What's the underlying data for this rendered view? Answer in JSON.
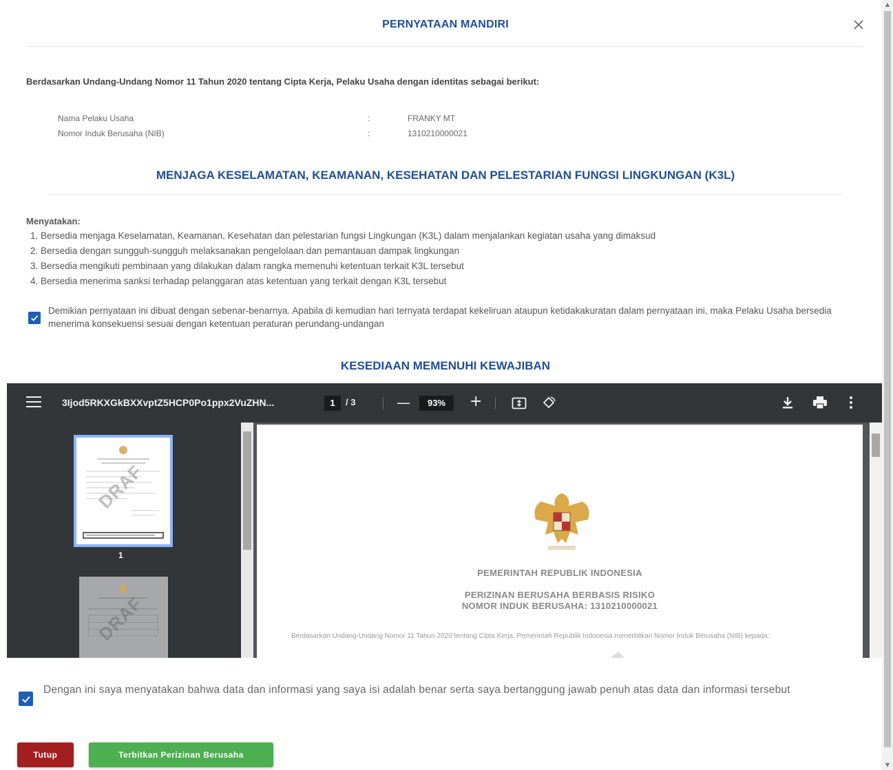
{
  "modal": {
    "title": "PERNYATAAN MANDIRI",
    "intro": "Berdasarkan Undang-Undang Nomor 11 Tahun 2020 tentang Cipta Kerja, Pelaku Usaha dengan identitas sebagai berikut:"
  },
  "identity": [
    {
      "label": "Nama Pelaku Usaha",
      "sep": ":",
      "value": "FRANKY MT"
    },
    {
      "label": "Nomor Induk Berusaha (NIB)",
      "sep": ":",
      "value": "1310210000021"
    }
  ],
  "k3l": {
    "title": "MENJAGA KESELAMATAN, KEAMANAN, KESEHATAN DAN PELESTARIAN FUNGSI LINGKUNGAN (K3L)",
    "statement_label": "Menyatakan:",
    "items": [
      "1. Bersedia menjaga Keselamatan, Keamanan, Kesehatan dan pelestarian fungsi Lingkungan (K3L) dalam menjalankan kegiatan usaha yang dimaksud",
      "2. Bersedia dengan sungguh-sungguh melaksanakan pengelolaan dan pemantauan dampak lingkungan",
      "3. Bersedia mengikuti pembinaan yang dilakukan dalam rangka memenuhi ketentuan terkait K3L tersebut",
      "4. Bersedia menerima sanksi terhadap pelanggaran atas ketentuan yang terkait dengan K3L tersebut"
    ],
    "declaration": "Demikian pernyataan ini dibuat dengan sebenar-benarnya. Apabila di kemudian hari ternyata terdapat kekeliruan ataupun ketidakakuratan dalam pernyataan ini, maka Pelaku Usaha bersedia menerima konsekuensi sesuai dengan ketentuan peraturan perundang-undangan"
  },
  "kewajiban": {
    "title": "KESEDIAAN MEMENUHI KEWAJIBAN"
  },
  "pdf": {
    "filename": "3Ijod5RKXGkBXXvptZ5HCP0Po1ppx2VuZHN...",
    "current_page": "1",
    "total_pages": "/ 3",
    "zoom": "93%",
    "thumb_number": "1",
    "watermark": "DRAF",
    "doc_heading": "PEMERINTAH REPUBLIK INDONESIA",
    "doc_subheading_1": "PERIZINAN BERUSAHA BERBASIS RISIKO",
    "doc_subheading_2": "NOMOR INDUK BERUSAHA: 1310210000021",
    "doc_paragraph": "Berdasarkan Undang-Undang Nomor 11 Tahun 2020 tentang Cipta Kerja, Pemerintah Republik Indonesia menerbitkan Nomor Induk Berusaha (NIB) kepada:"
  },
  "agreement": "Dengan ini saya menyatakan bahwa data dan informasi yang saya isi adalah benar serta saya bertanggung jawab penuh atas data dan informasi tersebut",
  "buttons": {
    "close": "Tutup",
    "issue": "Terbitkan Perizinan Berusaha"
  },
  "colors": {
    "title_blue": "#1f4e96",
    "checkbox_blue": "#1c5fb8",
    "close_red": "#a31f1f",
    "issue_green": "#4caf50"
  }
}
